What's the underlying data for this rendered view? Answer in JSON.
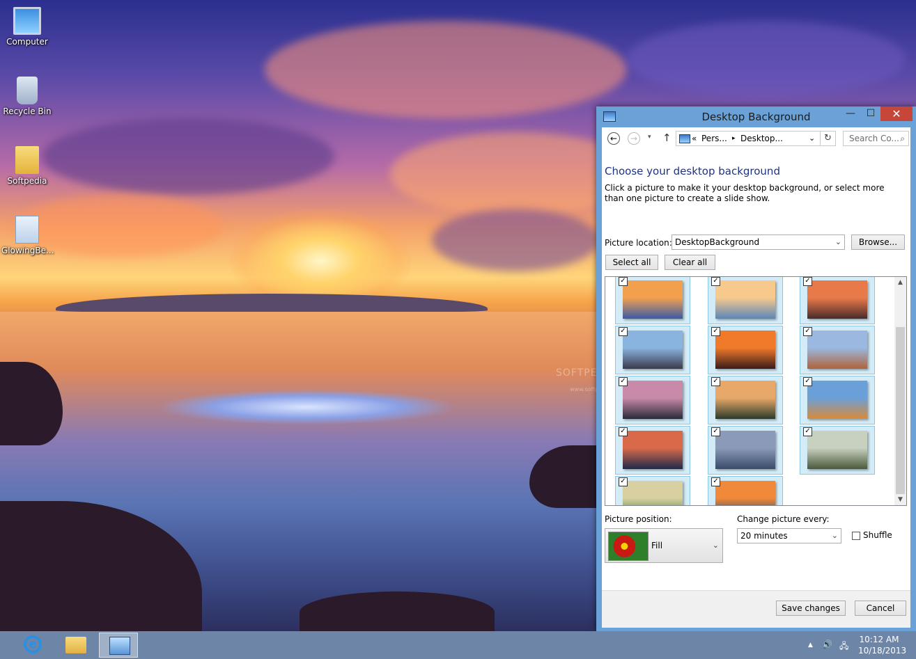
{
  "desktop_icons": [
    {
      "label": "Computer",
      "icon": "computer-icon"
    },
    {
      "label": "Recycle Bin",
      "icon": "recycle-bin-icon"
    },
    {
      "label": "Softpedia",
      "icon": "folder-icon"
    },
    {
      "label": "GlowingBe...",
      "icon": "theme-file-icon"
    }
  ],
  "watermark": {
    "line1": "SOFTPEDIA",
    "line2": "www.softpedia.com"
  },
  "window": {
    "title": "Desktop Background",
    "controls": {
      "minimize": "—",
      "maximize": "☐",
      "close": "✕"
    },
    "address": {
      "back": "←",
      "forward": "→",
      "dropdown": "▾",
      "up": "↑",
      "overflow": "«",
      "crumbs": [
        "Pers...",
        "Desktop..."
      ],
      "separator": "▸",
      "refresh": "↻",
      "search_placeholder": "Search Co..."
    },
    "heading": "Choose your desktop background",
    "description": "Click a picture to make it your desktop background, or select more than one picture to create a slide show.",
    "picture_location_label": "Picture location:",
    "picture_location_value": "DesktopBackground",
    "browse_label": "Browse...",
    "select_all_label": "Select all",
    "clear_all_label": "Clear all",
    "pictures": [
      {
        "checked": true,
        "colors": [
          "#f2a04e",
          "#3a5aa8"
        ]
      },
      {
        "checked": true,
        "colors": [
          "#f7c98c",
          "#5b86b8"
        ]
      },
      {
        "checked": true,
        "colors": [
          "#e87a4a",
          "#4a2a2a"
        ]
      },
      {
        "checked": true,
        "colors": [
          "#8ab4e0",
          "#3a3a4a"
        ]
      },
      {
        "checked": true,
        "colors": [
          "#f07a2a",
          "#3a1a1a"
        ]
      },
      {
        "checked": true,
        "colors": [
          "#9ab8e0",
          "#b0623a"
        ]
      },
      {
        "checked": true,
        "colors": [
          "#c88aa8",
          "#2a2a3a"
        ]
      },
      {
        "checked": true,
        "colors": [
          "#e8a86a",
          "#2a3a2a"
        ]
      },
      {
        "checked": true,
        "colors": [
          "#6aa0d8",
          "#d88a3a"
        ]
      },
      {
        "checked": true,
        "colors": [
          "#d86a4a",
          "#1e2a4a"
        ]
      },
      {
        "checked": true,
        "colors": [
          "#8a9ab8",
          "#3a4a6a"
        ]
      },
      {
        "checked": true,
        "colors": [
          "#c8d0c0",
          "#4a5a3a"
        ]
      },
      {
        "checked": true,
        "colors": [
          "#d8d0a0",
          "#3a7a3a"
        ]
      },
      {
        "checked": true,
        "colors": [
          "#f08a3a",
          "#1a3a6a"
        ]
      }
    ],
    "checkmark": "✓",
    "scroll": {
      "up": "▲",
      "down": "▼"
    },
    "picture_position_label": "Picture position:",
    "picture_position_value": "Fill",
    "change_picture_label": "Change picture every:",
    "change_picture_value": "20 minutes",
    "shuffle_label": "Shuffle",
    "shuffle_checked": false,
    "save_label": "Save changes",
    "cancel_label": "Cancel",
    "combo_arrow": "⌄"
  },
  "taskbar": {
    "items": [
      "internet-explorer-icon",
      "file-explorer-icon",
      "control-panel-icon"
    ],
    "ie_glyph": "e",
    "tray": {
      "expand": "▲",
      "speaker": "🔊",
      "network": "🖧"
    },
    "time": "10:12 AM",
    "date": "10/18/2013"
  },
  "colors": {
    "accent": "#6aa2d8",
    "close": "#c7463a",
    "heading": "#1e3287",
    "taskbar": "#6d86a8"
  }
}
